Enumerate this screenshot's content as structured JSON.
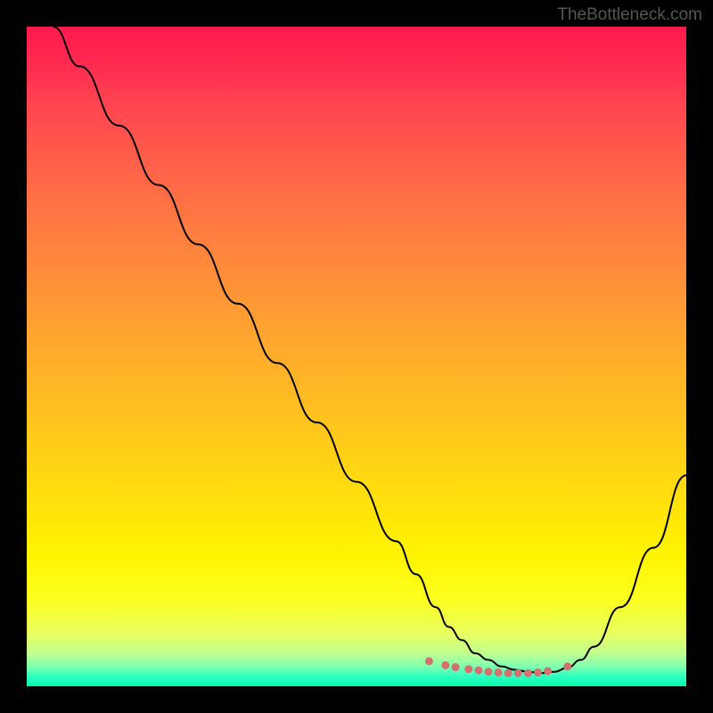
{
  "watermark": "TheBottleneck.com",
  "chart_data": {
    "type": "line",
    "title": "",
    "xlabel": "",
    "ylabel": "",
    "xlim": [
      0,
      100
    ],
    "ylim": [
      0,
      100
    ],
    "series": [
      {
        "name": "curve",
        "x": [
          4,
          8,
          14,
          20,
          26,
          32,
          38,
          44,
          50,
          56,
          59,
          62,
          64,
          66,
          68,
          70,
          72,
          74,
          76,
          78,
          80,
          82,
          84,
          86,
          90,
          95,
          100
        ],
        "y": [
          100,
          94,
          85,
          76,
          67,
          58,
          49,
          40,
          31,
          22,
          17,
          12,
          9,
          7,
          5,
          4,
          3,
          2.5,
          2.2,
          2,
          2.2,
          2.8,
          4,
          6,
          12,
          21,
          32
        ]
      }
    ],
    "markers": {
      "name": "dots",
      "x": [
        61,
        63.5,
        65,
        67,
        68.5,
        70,
        71.5,
        73,
        74.5,
        76,
        77.5,
        79,
        82
      ],
      "y": [
        3.8,
        3.2,
        2.9,
        2.6,
        2.4,
        2.2,
        2.1,
        2.0,
        2.0,
        2.0,
        2.1,
        2.3,
        3.0
      ]
    },
    "colors": {
      "line": "#000000",
      "marker": "#d4706f",
      "background_top": "#ff1a4d",
      "background_bottom": "#00ffaa"
    }
  }
}
